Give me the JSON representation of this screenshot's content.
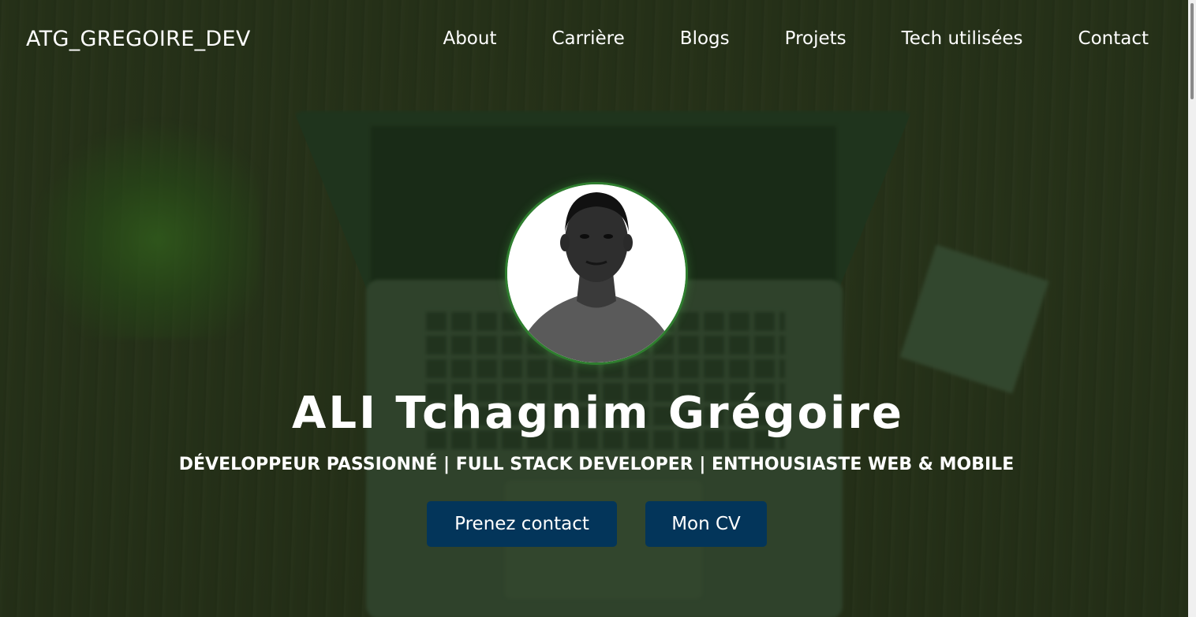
{
  "nav": {
    "brand": "ATG_GREGOIRE_DEV",
    "links": [
      {
        "label": "About"
      },
      {
        "label": "Carrière"
      },
      {
        "label": "Blogs"
      },
      {
        "label": "Projets"
      },
      {
        "label": "Tech utilisées"
      },
      {
        "label": "Contact"
      }
    ]
  },
  "hero": {
    "name": "ALI Tchagnim Grégoire",
    "tagline": "DÉVELOPPEUR PASSIONNÉ | FULL STACK DEVELOPER | ENTHOUSIASTE WEB & MOBILE",
    "buttons": {
      "contact": "Prenez contact",
      "cv": "Mon CV"
    }
  },
  "colors": {
    "overlay": "#163012",
    "button": "#03355a",
    "avatar_ring": "#2e7d2e",
    "text": "#ffffff"
  }
}
